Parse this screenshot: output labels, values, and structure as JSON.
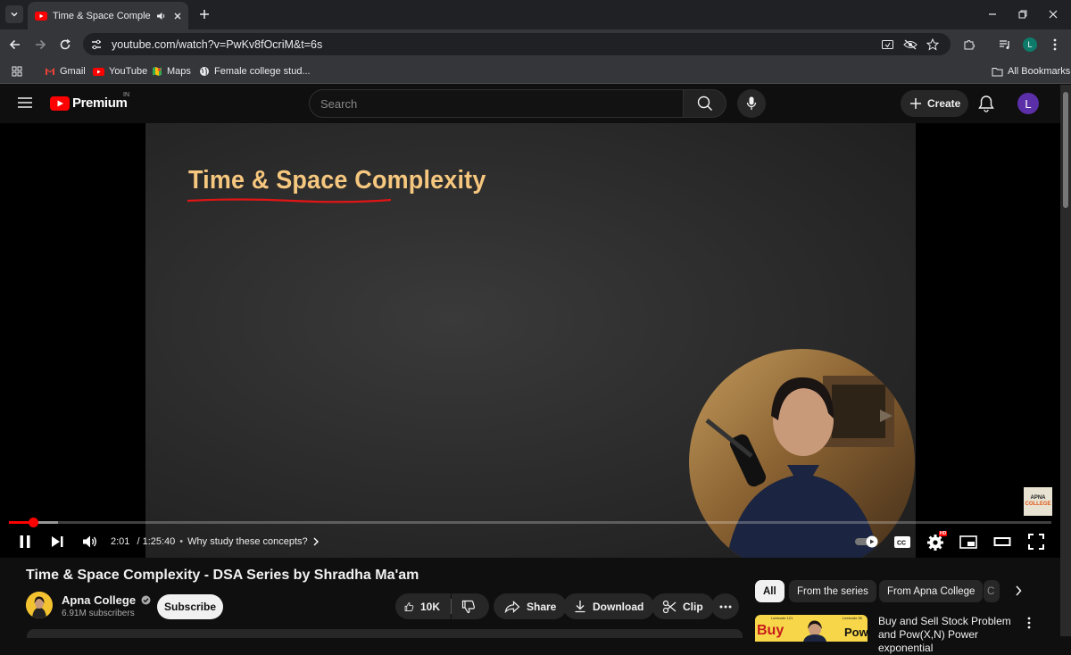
{
  "browser": {
    "tab": {
      "title": "Time & Space Complexity -",
      "favicon": "youtube-favicon-icon",
      "audio_icon": "speaker-icon"
    },
    "url": "youtube.com/watch?v=PwKv8fOcriM&t=6s",
    "profile_initial": "L",
    "bookmarks": [
      {
        "label": "Gmail",
        "icon": "gmail-icon"
      },
      {
        "label": "YouTube",
        "icon": "youtube-icon"
      },
      {
        "label": "Maps",
        "icon": "maps-icon"
      },
      {
        "label": "Female college stud...",
        "icon": "globe-icon"
      }
    ],
    "all_bookmarks": "All Bookmarks"
  },
  "youtube": {
    "logo_text": "Premium",
    "region": "IN",
    "search_placeholder": "Search",
    "create_label": "Create",
    "avatar_initial": "L"
  },
  "player": {
    "slide_title": "Time & Space Complexity",
    "logo_line1": "APNA",
    "logo_line2": "COLLEGE",
    "time_current": "2:01",
    "time_total": "1:25:40",
    "separator": " / ",
    "chapter": "Why study these concepts?",
    "progress_fraction": 0.0235,
    "settings_badge": "HD"
  },
  "video": {
    "title": "Time & Space Complexity - DSA Series by Shradha Ma'am",
    "channel": "Apna College",
    "subscribers": "6.91M subscribers",
    "subscribe_label": "Subscribe",
    "likes": "10K",
    "share_label": "Share",
    "download_label": "Download",
    "clip_label": "Clip"
  },
  "sidebar": {
    "chips": [
      "All",
      "From the series",
      "From Apna College",
      "C"
    ],
    "recommendation": {
      "title": "Buy and Sell Stock Problem and Pow(X,N) Power exponential",
      "thumb_left": "Buy",
      "thumb_right": "Pow",
      "thumb_tag_left": "Leetcode 121",
      "thumb_tag_right": "Leetcode 50"
    }
  },
  "colors": {
    "youtube_red": "#ff0000",
    "slide_title": "#f6c77e",
    "background": "#0f0f0f",
    "chrome_dark": "#202124",
    "chrome_mid": "#35363a"
  }
}
